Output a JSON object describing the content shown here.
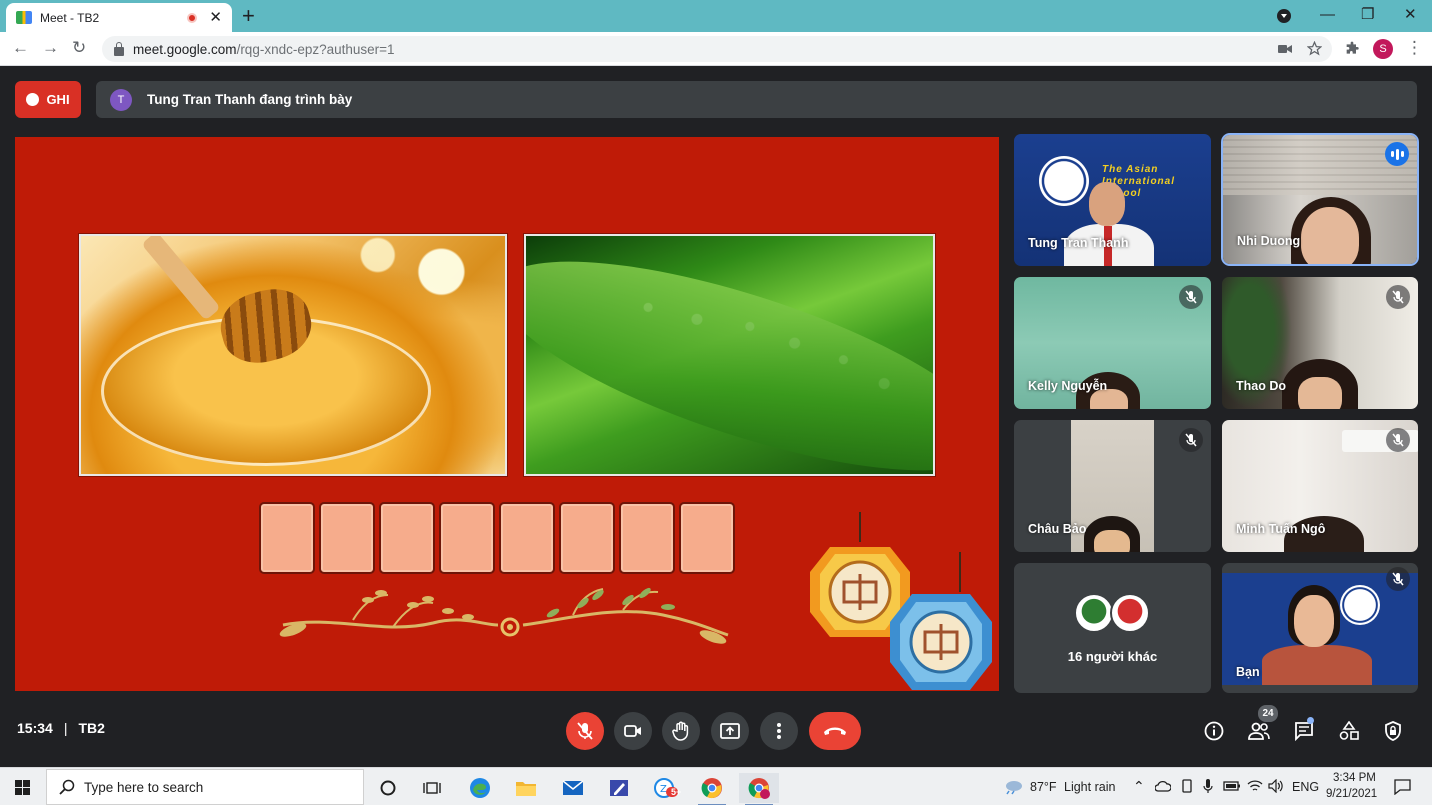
{
  "browser": {
    "tab_title": "Meet - TB2",
    "new_tab": "+",
    "close_tab": "✕",
    "url_host": "meet.google.com",
    "url_path": "/rqg-xndc-epz?authuser=1",
    "profile_initial": "S"
  },
  "meet": {
    "record_label": "GHI",
    "presenter_initial": "T",
    "presenting_text": "Tung Tran Thanh đang trình bày",
    "time": "15:34",
    "meeting_code": "TB2",
    "participant_count": "24"
  },
  "slide": {
    "letter_tile_count": 8
  },
  "participants": [
    {
      "name": "Tung Tran Thanh",
      "school_text": "The Asian\nInternational\nSchool",
      "status": "none"
    },
    {
      "name": "Nhi Duong",
      "status": "speaking"
    },
    {
      "name": "Kelly Nguyễn",
      "status": "muted"
    },
    {
      "name": "Thao Do",
      "status": "muted"
    },
    {
      "name": "Châu Bảo",
      "status": "muted"
    },
    {
      "name": "Minh Tuấn Ngô",
      "status": "muted"
    },
    {
      "name": "16 người khác",
      "status": "none"
    },
    {
      "name": "Bạn",
      "status": "muted"
    }
  ],
  "taskbar": {
    "search_placeholder": "Type here to search",
    "weather_temp": "87°F",
    "weather_desc": "Light rain",
    "language": "ENG",
    "clock_time": "3:34 PM",
    "clock_date": "9/21/2021",
    "notification_badge": "5+"
  },
  "colors": {
    "slide_background": "#bf1b07",
    "record_red": "#d93025",
    "tile_fill": "#f6ac8c",
    "active_speaker": "#8ab4f8"
  }
}
